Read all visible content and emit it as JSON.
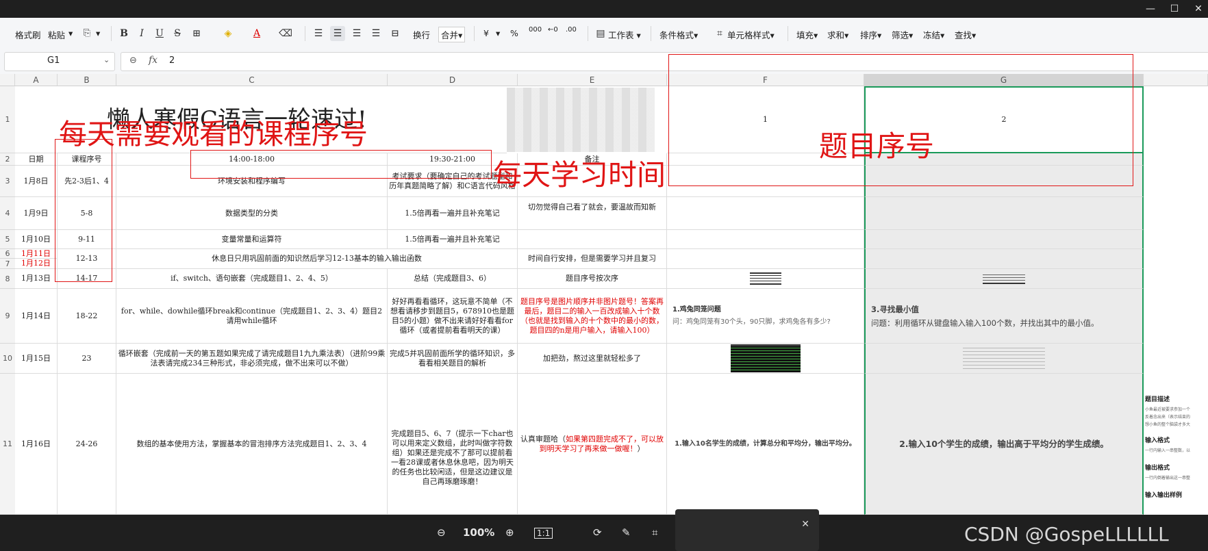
{
  "window": {
    "minimize": "—",
    "maximize": "☐",
    "close": "✕"
  },
  "toolbar": {
    "format_painter": "格式刷",
    "paste": "粘贴",
    "bold": "B",
    "italic": "I",
    "underline": "U",
    "strike": "S",
    "wrap": "换行",
    "merge": "合并",
    "currency": "¥",
    "percent": "%",
    "thousands": "000",
    "worksheet": "工作表",
    "cond_format": "条件格式",
    "cell_style": "单元格样式",
    "fill": "填充",
    "sum": "求和",
    "sort": "排序",
    "filter": "筛选",
    "freeze": "冻结",
    "find": "查找"
  },
  "formula_bar": {
    "name_box": "G1",
    "fx": "fx",
    "value": "2"
  },
  "columns": [
    "A",
    "B",
    "C",
    "D",
    "E",
    "F",
    "G"
  ],
  "rows": [
    "1",
    "2",
    "3",
    "4",
    "5",
    "6",
    "7",
    "8",
    "9",
    "10",
    "11"
  ],
  "sheet": {
    "title": "懒人寒假C语言一轮速过!",
    "f1": "1",
    "g1": "2",
    "h_date": "日期",
    "h_course": "课程序号",
    "h_c": "14:00-18:00",
    "h_d": "19:30-21:00",
    "h_e": "备注",
    "r3": {
      "a": "1月8日",
      "b": "先2-3后1、4",
      "c": "环境安装和程序编写",
      "d": "考试要求（要确定自己的考试题型和历年真题简略了解）和C语言代码风格"
    },
    "r4": {
      "a": "1月9日",
      "b": "5-8",
      "c": "数据类型的分类",
      "d": "1.5倍再看一遍并且补充笔记",
      "e": "切勿觉得自己看了就会，要温故而知新"
    },
    "r5": {
      "a": "1月10日",
      "b": "9-11",
      "c": "变量常量和运算符",
      "d": "1.5倍再看一遍并且补充笔记"
    },
    "r67": {
      "a6": "1月11日",
      "a7": "1月12日",
      "b": "12-13",
      "cd": "休息日只用巩固前面的知识然后学习12-13基本的输入输出函数",
      "e": "时间自行安排，但是需要学习并且复习"
    },
    "r8": {
      "a": "1月13日",
      "b": "14-17",
      "c": "if、switch、语句嵌套（完成题目1、2、4、5）",
      "d": "总结（完成题目3、6）",
      "e": "题目序号按次序"
    },
    "r9": {
      "a": "1月14日",
      "b": "18-22",
      "c": "for、while、dowhile循环break和continue（完成题目1、2、3、4）题目2请用while循环",
      "d": "好好再看看循环，这玩意不简单（不想看请移步到题目5，678910也是题目5的小题）做不出来请好好看看for循环（或者提前看看明天的课）",
      "e": "题目序号是图片顺序并非图片题号！答案再最后，题目二的输入一百改成输入十个数（也就是找到输入的十个数中的最小的数，题目四的n是用户输入，请输入100）",
      "f_title": "1.鸡兔同笼问题",
      "f_body": "问：鸡兔同笼有30个头，90只脚，求鸡兔各有多少?",
      "g_title": "3.寻找最小值",
      "g_body": "问题：利用循环从键盘输入输入100个数，并找出其中的最小值。"
    },
    "r10": {
      "a": "1月15日",
      "b": "23",
      "c": "循环嵌套（完成前一天的第五题如果完成了请完成题目1九九乘法表）（进阶99乘法表请完成234三种形式，非必须完成，做不出来可以不做）",
      "d": "完成5并巩固前面所学的循环知识，多看看相关题目的解析",
      "e": "加把劲，熬过这里就轻松多了"
    },
    "r11": {
      "a": "1月16日",
      "b": "24-26",
      "c": "数组的基本使用方法，掌握基本的冒泡排序方法完成题目1、2、3、4",
      "d": "完成题目5、6、7（提示一下char也可以用来定义数组，此时叫做字符数组）如果还是完成不了那可以提前看一看28课或者休息休息吧，因为明天的任务也比较闲适，但是这边建议是自己再琢磨琢磨！",
      "e_pre": "认真审题哈（",
      "e_red": "如果第四题完成不了，可以放到明天学习了再来做一做喔！",
      "e_post": "）",
      "f": "1.输入10名学生的成绩，计算总分和平均分，输出平均分。",
      "g": "2.输入10个学生的成绩，输出高于平均分的学生成绩。"
    },
    "side": {
      "t1": "题目描述",
      "t2": "输入格式",
      "t3": "输出格式",
      "t4": "输入输出样例",
      "s1": "小鱼最近被要求参加一个",
      "s2": "反着念出来（表示结束的",
      "s3": "想小鱼的整个脑袋才多大",
      "s4": "一行内输入一串整数，以",
      "s5": "一行内倒着输出这一串整"
    }
  },
  "annotations": {
    "course": "每天需要观看的课程序号",
    "time": "每天学习时间",
    "question": "题目序号"
  },
  "bottom": {
    "zoom": "100%",
    "ratio": "1:1",
    "watermark": "CSDN @GospeLLLLLL",
    "close": "✕"
  }
}
